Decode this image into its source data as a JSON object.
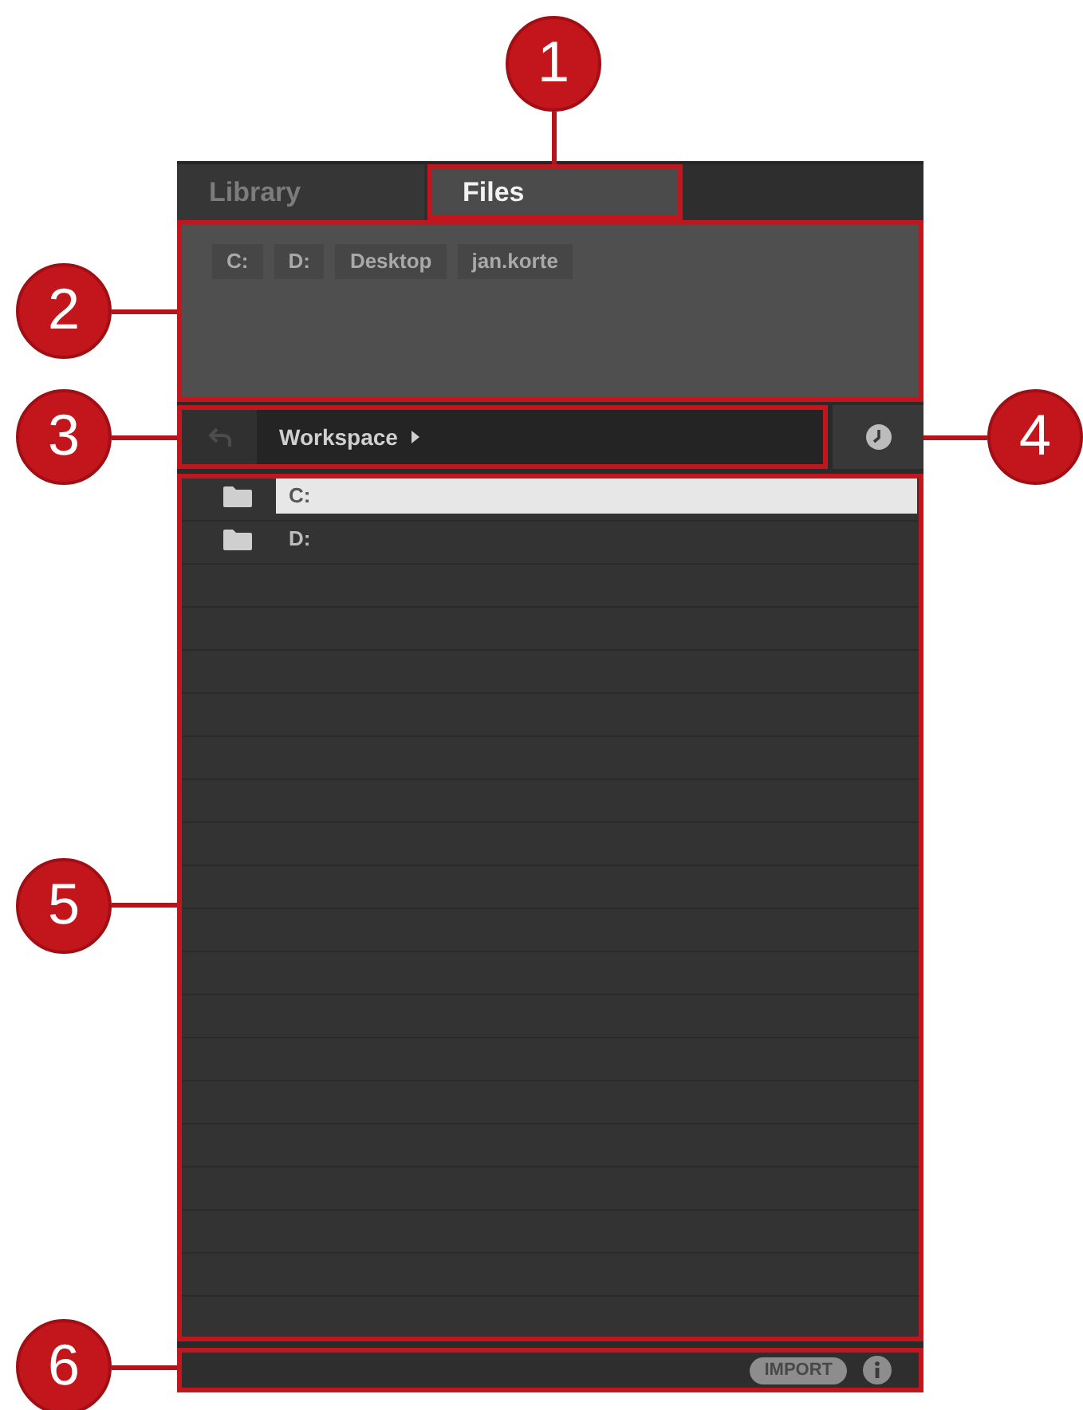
{
  "tabs": [
    {
      "label": "Library",
      "selected": false
    },
    {
      "label": "Files",
      "selected": true,
      "callout": {
        "number": "1",
        "framed": true
      }
    }
  ],
  "favorites": {
    "items": [
      {
        "label": "C:"
      },
      {
        "label": "D:"
      },
      {
        "label": "Desktop"
      },
      {
        "label": "jan.korte"
      }
    ],
    "callout": {
      "number": "2",
      "framed": true
    }
  },
  "location": {
    "back_button": {
      "disabled": true
    },
    "path": [
      {
        "label": "Workspace"
      }
    ],
    "callout": {
      "number": "3",
      "framed": true
    }
  },
  "recent_button": {
    "callout": {
      "number": "4",
      "framed": false
    }
  },
  "file_list": {
    "rows": [
      {
        "name": "C:",
        "kind": "folder",
        "selected": true
      },
      {
        "name": "D:",
        "kind": "folder",
        "selected": false
      }
    ],
    "callout": {
      "number": "5",
      "framed": true
    }
  },
  "footer": {
    "import_label": "IMPORT",
    "callout": {
      "number": "6",
      "framed": true
    }
  }
}
